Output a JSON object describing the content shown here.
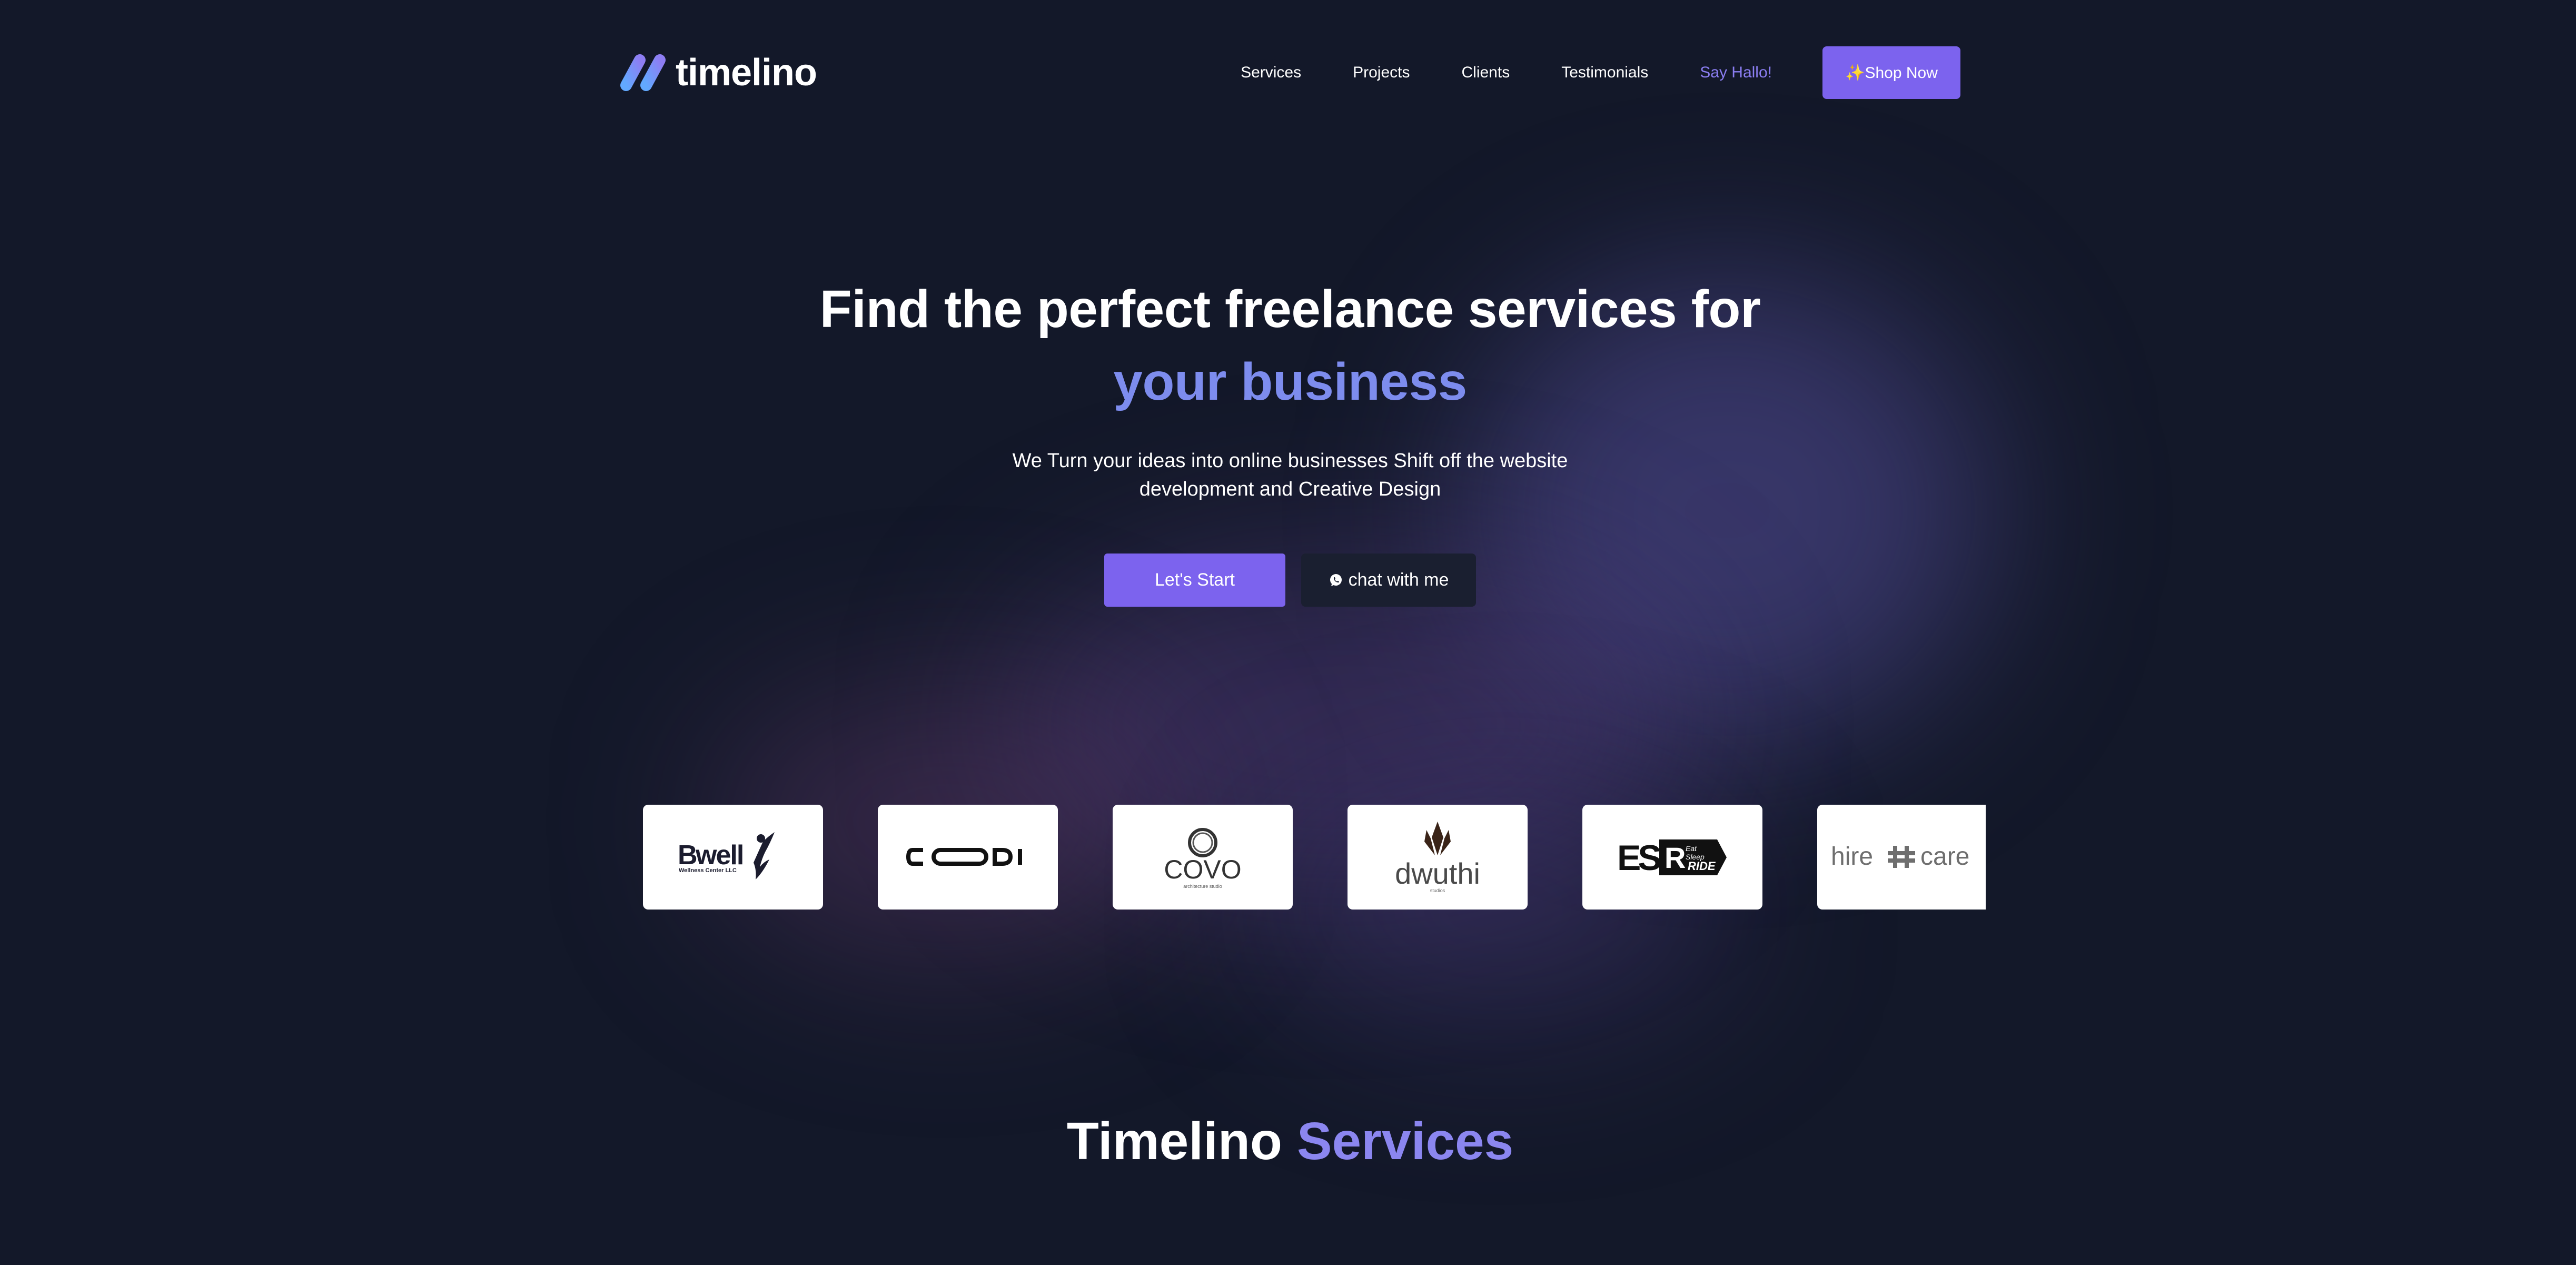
{
  "brand": {
    "name": "timelino"
  },
  "nav": {
    "items": [
      "Services",
      "Projects",
      "Clients",
      "Testimonials"
    ],
    "say_hallo": "Say Hallo!",
    "shop_now": "✨Shop Now"
  },
  "hero": {
    "title_line1": "Find the perfect freelance services for",
    "title_line2": "your business",
    "subtitle_line1": "We Turn your ideas into online businesses Shift off the website",
    "subtitle_line2": "development and Creative Design",
    "start_button": "Let's Start",
    "chat_button": "chat with me"
  },
  "clients": {
    "logos": [
      {
        "name": "Bwell",
        "tagline": "Wellness Center LLC"
      },
      {
        "name": "CODI"
      },
      {
        "name": "COVO",
        "tagline": "architecture studio"
      },
      {
        "name": "dwuthi",
        "tagline": "studios"
      },
      {
        "name": "ESR",
        "tagline": "Eat Sleep Ride"
      },
      {
        "name_left": "hire",
        "name_right": "care"
      }
    ]
  },
  "services": {
    "title_main": "Timelino",
    "title_accent": "Services"
  },
  "colors": {
    "background": "#131829",
    "accent": "#7c63ee",
    "accent_text": "#7d8cee"
  }
}
